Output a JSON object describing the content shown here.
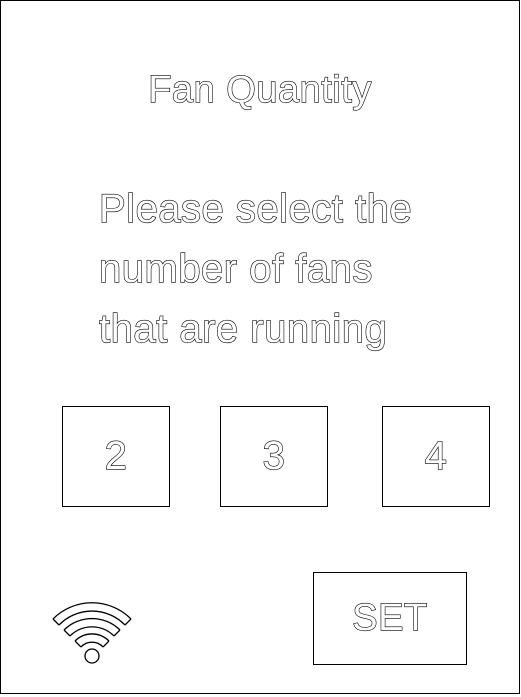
{
  "screen": {
    "title": "Fan Quantity",
    "prompt_lines": [
      "Please select the",
      "number of fans",
      "that are running"
    ]
  },
  "options": [
    {
      "label": "2"
    },
    {
      "label": "3"
    },
    {
      "label": "4"
    }
  ],
  "actions": {
    "set_label": "SET"
  },
  "status": {
    "connectivity_icon": "wifi-icon"
  },
  "colors": {
    "background": "#ffffff",
    "outline": "#000000"
  }
}
